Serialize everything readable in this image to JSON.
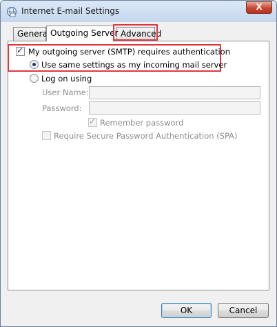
{
  "window": {
    "title": "Internet E-mail Settings",
    "close_glyph": "X",
    "icon": "globe-mail-icon"
  },
  "tabs": [
    {
      "label": "General",
      "active": false
    },
    {
      "label": "Outgoing Server",
      "active": true
    },
    {
      "label": "Advanced",
      "active": false,
      "highlighted": true
    }
  ],
  "outgoing": {
    "smtp_auth_label": "My outgoing server (SMTP) requires authentication",
    "smtp_auth_checked": true,
    "same_settings_label": "Use same settings as my incoming mail server",
    "same_settings_selected": true,
    "log_on_label": "Log on using",
    "log_on_selected": false,
    "user_name_label": "User Name:",
    "user_name_value": "",
    "password_label": "Password:",
    "password_value": "",
    "remember_password_label": "Remember password",
    "remember_password_checked": true,
    "spa_label": "Require Secure Password Authentication (SPA)",
    "spa_checked": false
  },
  "buttons": {
    "ok": "OK",
    "cancel": "Cancel"
  },
  "colors": {
    "highlight": "#e0363b",
    "titlebar": "#c5d7ee"
  }
}
